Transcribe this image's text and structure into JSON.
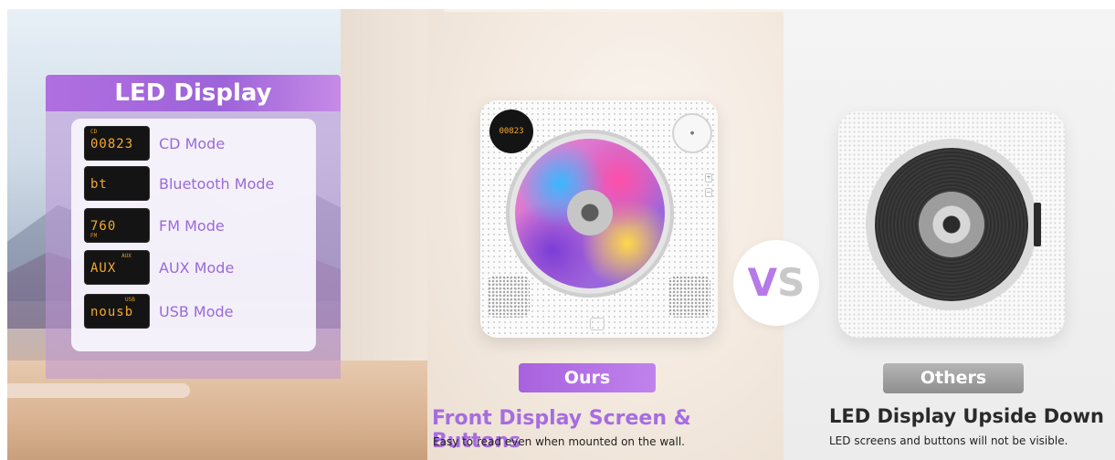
{
  "left_panel": {
    "heading": "LED Display",
    "modes": [
      {
        "lcd_tag": "CD",
        "lcd_text": "00823",
        "label": "CD Mode"
      },
      {
        "lcd_tag": "",
        "lcd_text": "bt",
        "label": "Bluetooth Mode"
      },
      {
        "lcd_tag": "FM",
        "lcd_text": "760",
        "label": "FM Mode"
      },
      {
        "lcd_tag": "AUX",
        "lcd_text": "AUX",
        "label": "AUX Mode"
      },
      {
        "lcd_tag": "USB",
        "lcd_text": "nousb",
        "label": "USB Mode"
      }
    ]
  },
  "ours": {
    "device_display": "00823",
    "badge": "Ours",
    "title": "Front Display Screen & Buttons",
    "subtitle": "Easy to read even when mounted on the wall."
  },
  "vs": {
    "v": "V",
    "s": "S"
  },
  "others": {
    "badge": "Others",
    "title": "LED Display Upside Down",
    "subtitle": "LED screens and buttons will not be visible."
  },
  "colors": {
    "accent_purple": "#a66de0",
    "lcd_digits": "#f4a830",
    "others_gray": "#9a9a9a"
  }
}
